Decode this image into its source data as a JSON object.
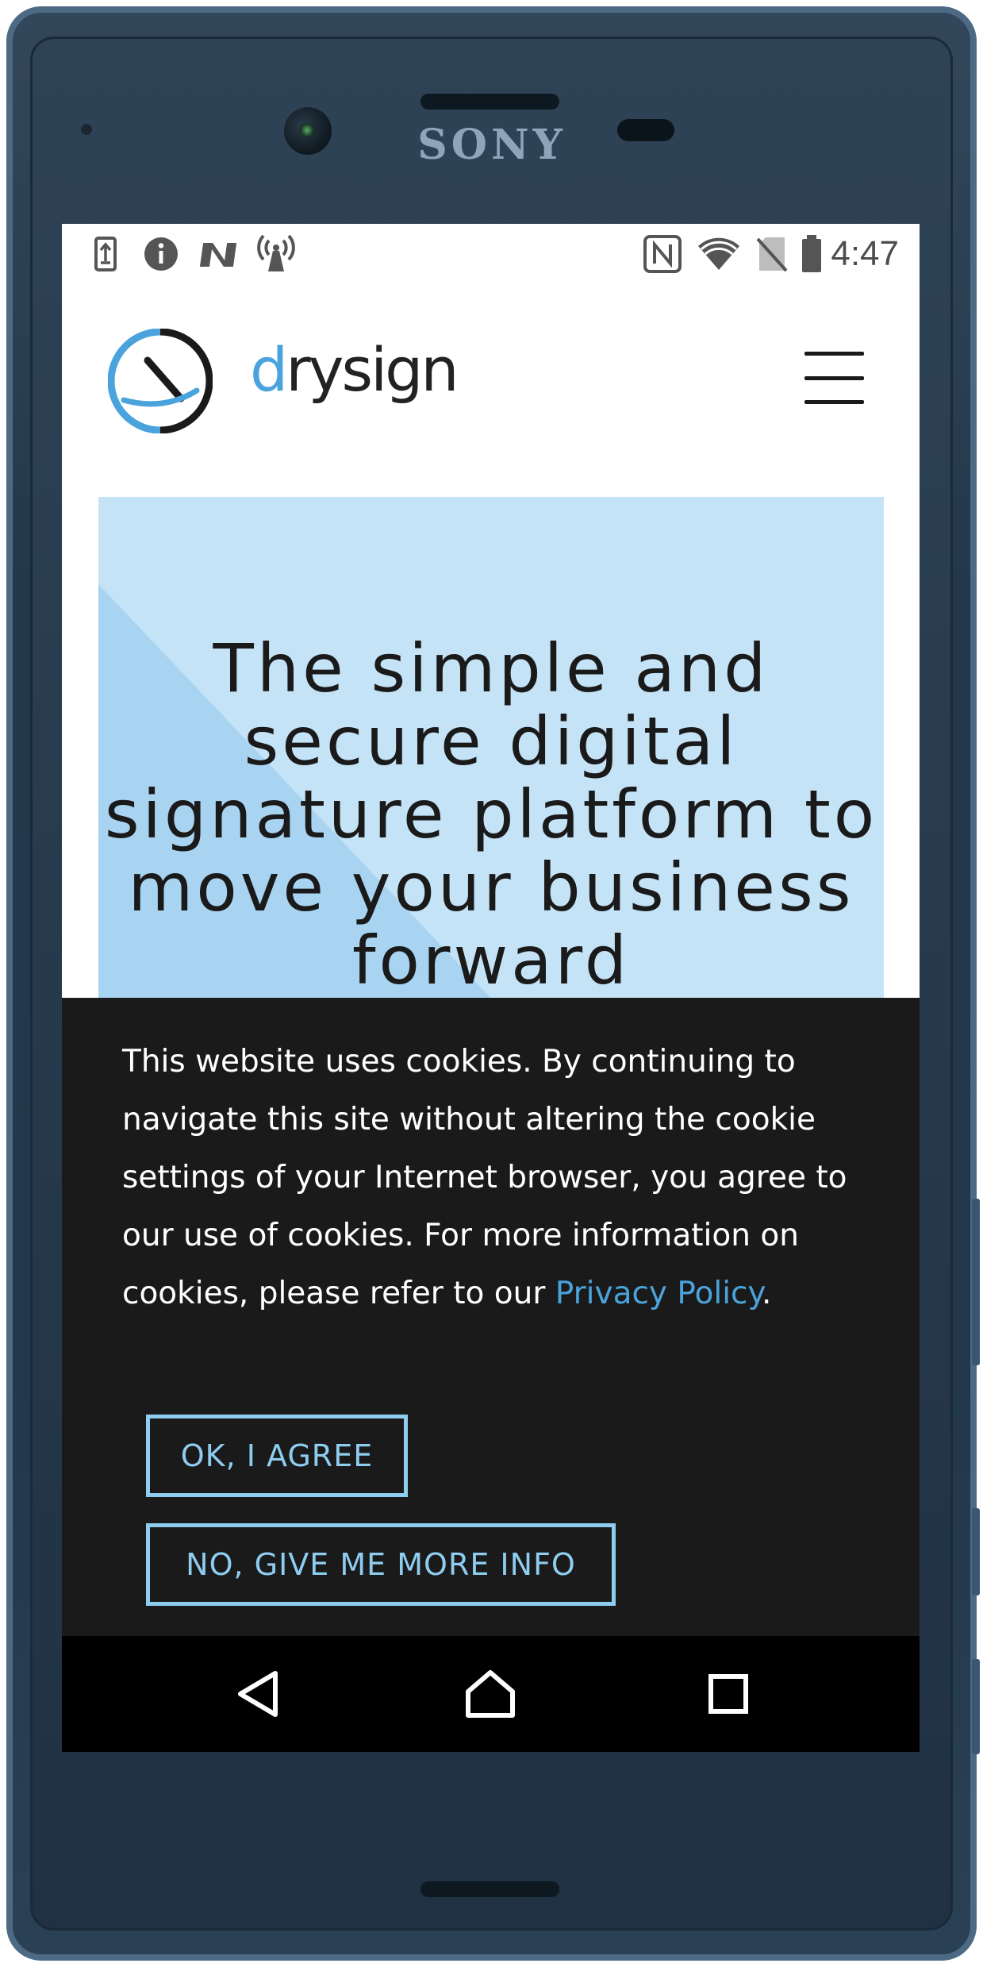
{
  "device": {
    "brand": "SONY"
  },
  "status_bar": {
    "left_icons": [
      "usb-transfer-icon",
      "info-icon",
      "n-notification-icon",
      "hotspot-icon"
    ],
    "right_icons": [
      "nfc-icon",
      "wifi-icon",
      "no-sim-icon",
      "battery-icon"
    ],
    "time": "4:47"
  },
  "header": {
    "logo_text_accent": "d",
    "logo_text_rest": "rysign",
    "menu_icon": "hamburger-menu-icon"
  },
  "hero": {
    "title": "The simple and secure digital signature platform to move your business forward",
    "bg_color": "#c4e3f6",
    "accent_color": "#a8d4f2"
  },
  "cookie_banner": {
    "text_before_link": "This website uses cookies. By continuing to navigate this site without altering the cookie settings of your Internet browser, you agree to our use of cookies. For more information on cookies, please refer to our ",
    "link_text": "Privacy Policy",
    "text_after_link": ".",
    "agree_button": "OK, I AGREE",
    "more_info_button": "NO, GIVE ME MORE INFO",
    "link_color": "#4aa3dc",
    "button_color": "#8ecdf0"
  },
  "nav_bar": {
    "back_icon": "back-triangle-icon",
    "home_icon": "home-icon",
    "recents_icon": "recents-square-icon"
  }
}
